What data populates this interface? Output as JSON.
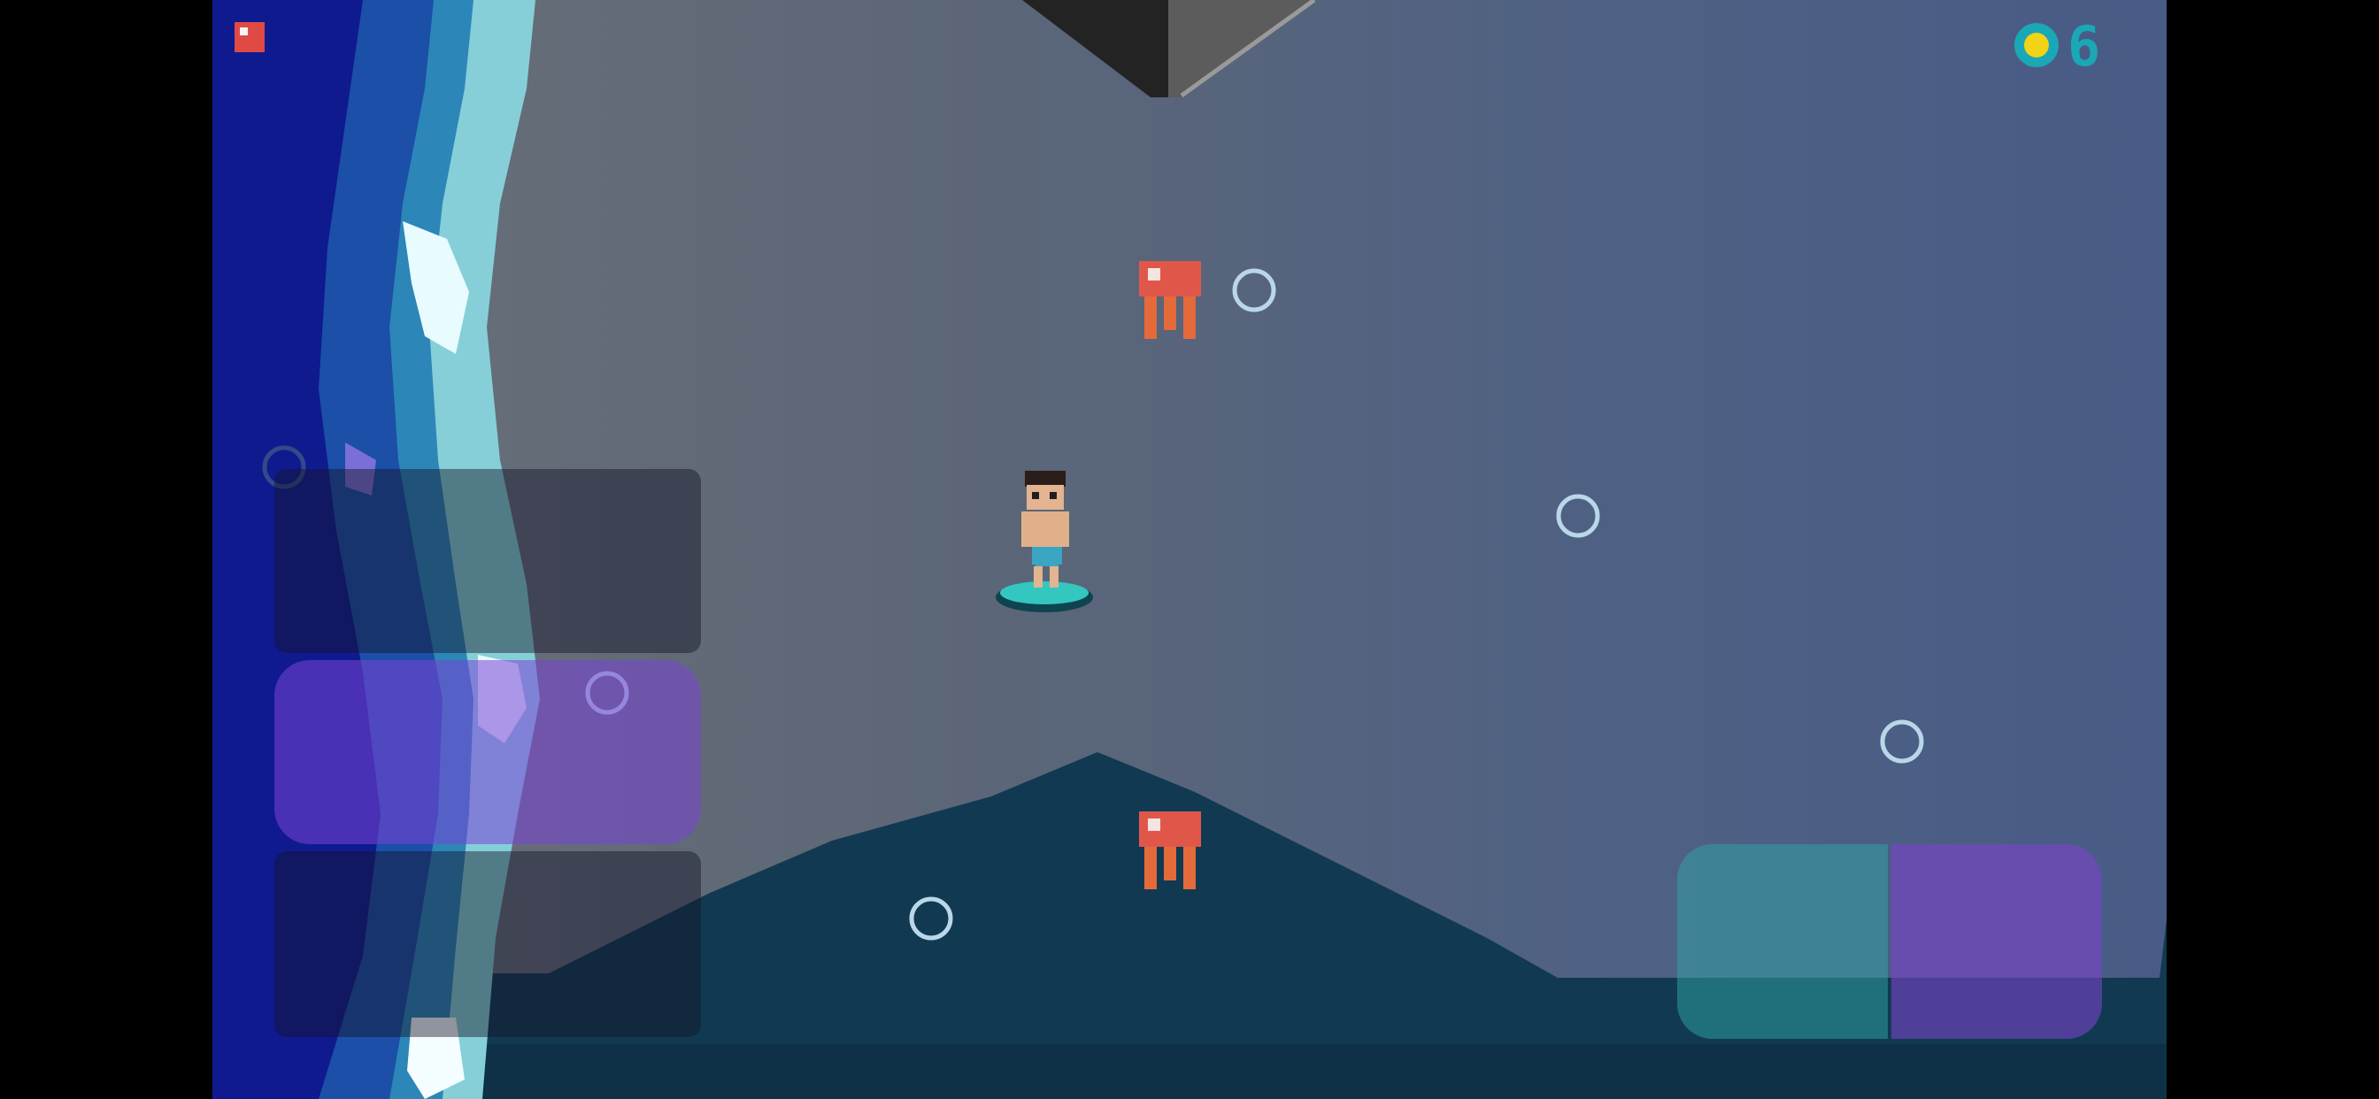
{
  "hud": {
    "coin_count": "6",
    "coin_icon": "gold-coin-icon",
    "pause_icon": "pause-square-icon"
  },
  "colors": {
    "background_left": "#6a717a",
    "background_right": "#485b86",
    "wave_deep": "#0f1a8f",
    "wave_mid": "#1d5aa8",
    "wave_foam": "#e6fbff",
    "seafloor": "#113a52",
    "jellyfish": "#e0574a",
    "surfboard": "#33c7c0",
    "coin": "#f2d316",
    "pause": "#e04a45",
    "left_button_active": "#7a43d6",
    "right_button_teal": "#2fa6a6",
    "right_button_purple": "#7a43c9"
  },
  "controls": {
    "left_pad": [
      "up-button",
      "middle-button",
      "down-button"
    ],
    "right_pad": [
      "left-button",
      "right-button"
    ]
  }
}
